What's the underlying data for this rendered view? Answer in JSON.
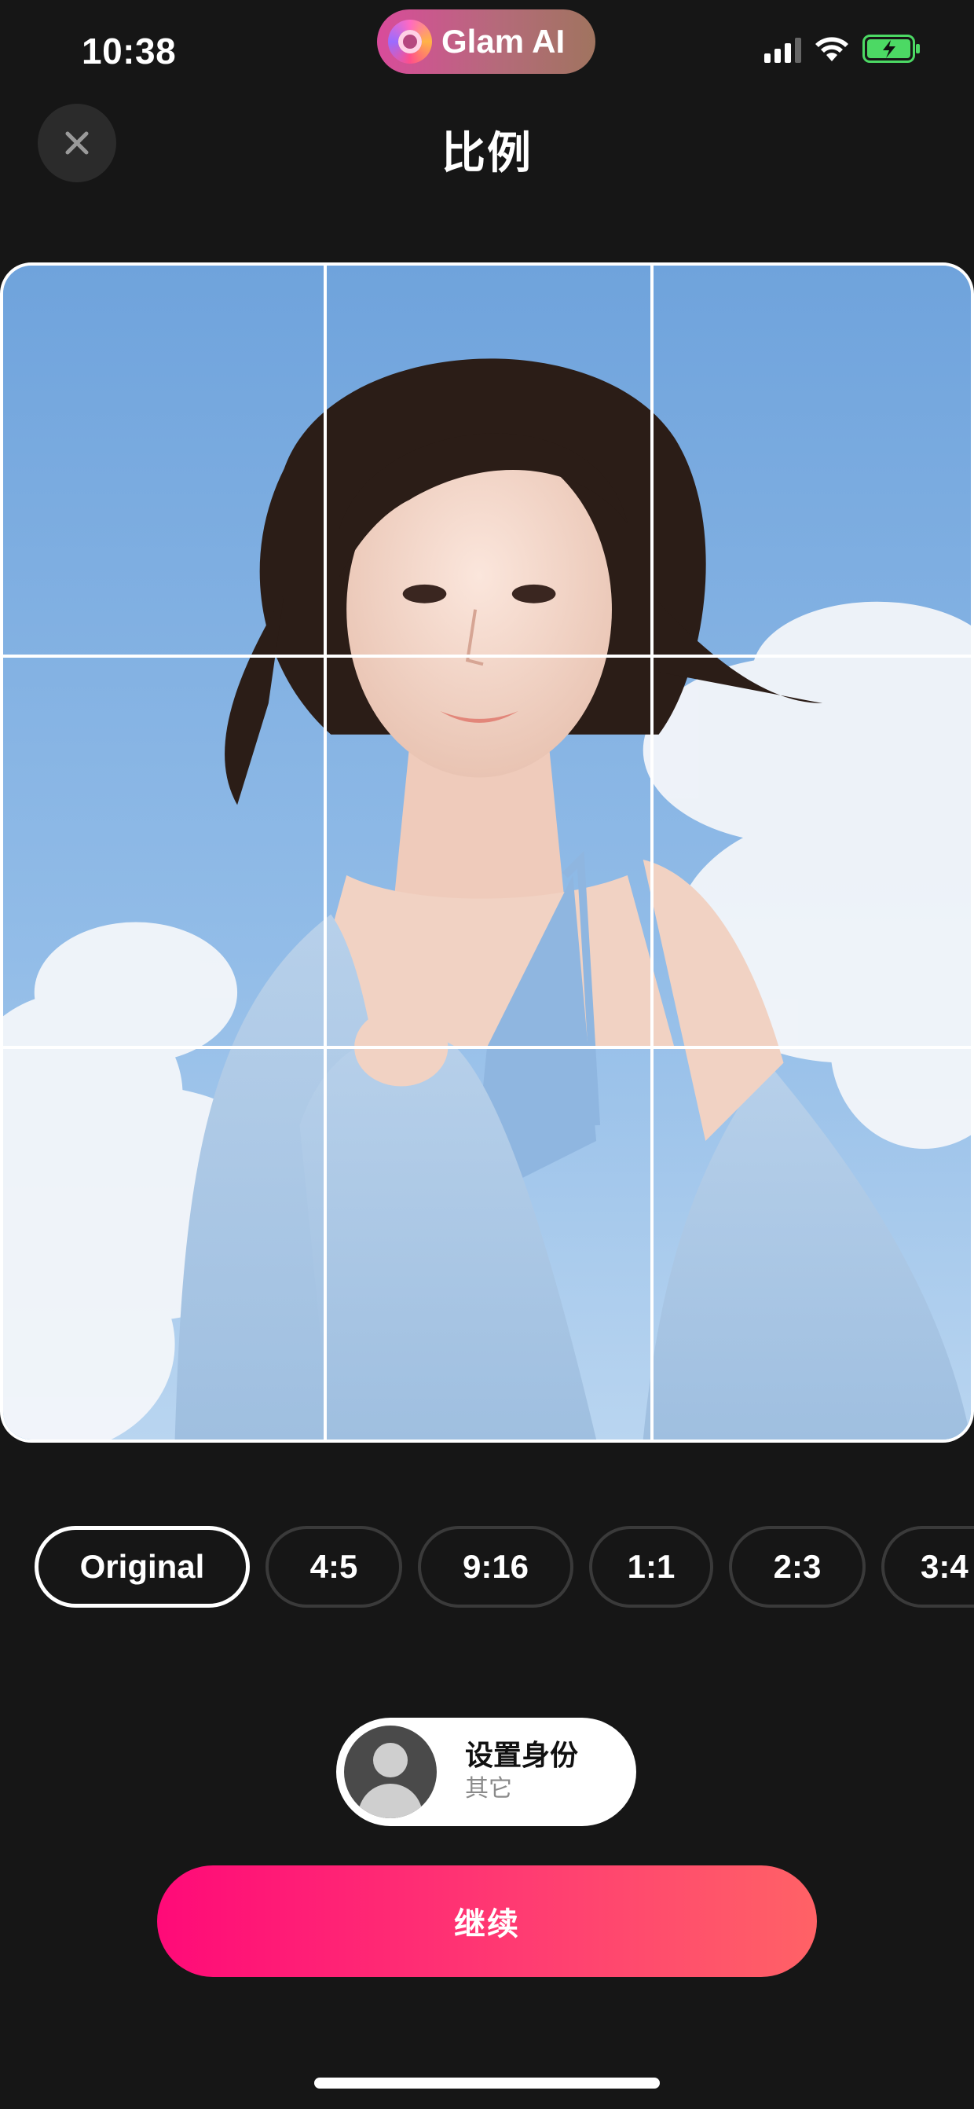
{
  "status_bar": {
    "time": "10:38",
    "app_pill_title": "Glam AI",
    "icons": [
      "cellular-signal-icon",
      "wifi-icon",
      "battery-charging-icon"
    ]
  },
  "header": {
    "title": "比例",
    "close_icon": "close-icon"
  },
  "ratio_options": [
    "Original",
    "4:5",
    "9:16",
    "1:1",
    "2:3",
    "3:4"
  ],
  "selected_ratio": "Original",
  "identity": {
    "title": "设置身份",
    "subtitle": "其它",
    "avatar_icon": "default-avatar-icon"
  },
  "continue_button": {
    "label": "继续"
  },
  "colors": {
    "background": "#161616",
    "accent_start": "#ff0a78",
    "accent_end": "#ff6266",
    "chip_border": "#3a3a3a"
  }
}
